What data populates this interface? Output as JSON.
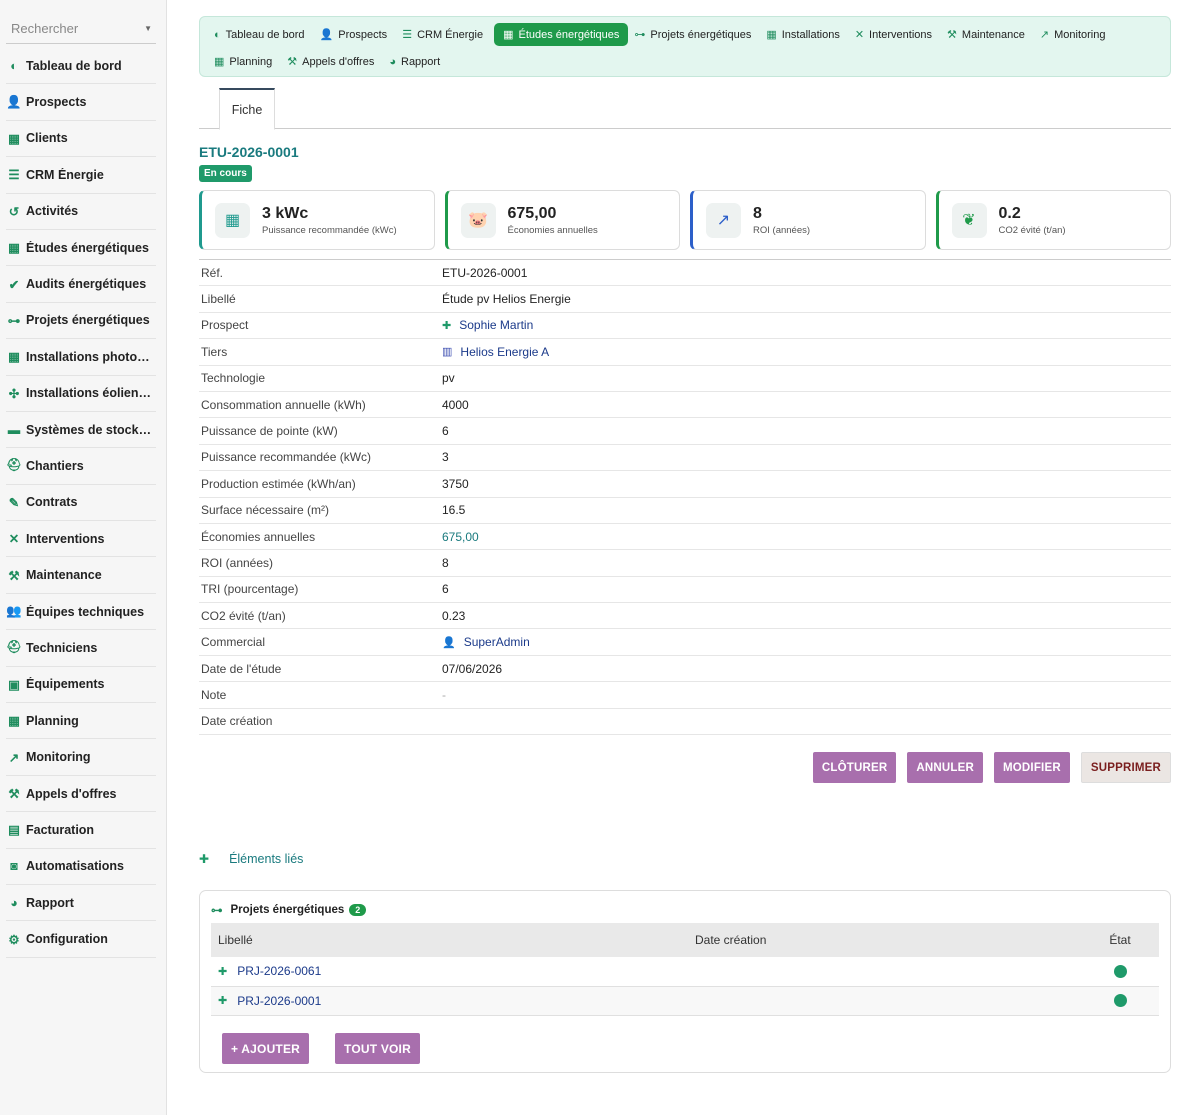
{
  "search": {
    "placeholder": "Rechercher"
  },
  "sidebar": {
    "items": [
      {
        "label": "Tableau de bord",
        "icon": "gauge-icon",
        "glyph": "◐"
      },
      {
        "label": "Prospects",
        "icon": "user-plus-icon",
        "glyph": "👤"
      },
      {
        "label": "Clients",
        "icon": "building-icon",
        "glyph": "▦"
      },
      {
        "label": "CRM Énergie",
        "icon": "list-icon",
        "glyph": "☰"
      },
      {
        "label": "Activités",
        "icon": "history-icon",
        "glyph": "↺"
      },
      {
        "label": "Études énergétiques",
        "icon": "solar-panel-icon",
        "glyph": "▦"
      },
      {
        "label": "Audits énergétiques",
        "icon": "clipboard-check-icon",
        "glyph": "✔"
      },
      {
        "label": "Projets énergétiques",
        "icon": "project-diagram-icon",
        "glyph": "⊶"
      },
      {
        "label": "Installations photov…",
        "icon": "solar-panel-icon",
        "glyph": "▦"
      },
      {
        "label": "Installations éoliennes",
        "icon": "wind-turbine-icon",
        "glyph": "✣"
      },
      {
        "label": "Systèmes de stockage",
        "icon": "battery-icon",
        "glyph": "▬"
      },
      {
        "label": "Chantiers",
        "icon": "hard-hat-icon",
        "glyph": "⛑"
      },
      {
        "label": "Contrats",
        "icon": "file-signature-icon",
        "glyph": "✎"
      },
      {
        "label": "Interventions",
        "icon": "tools-icon",
        "glyph": "✕"
      },
      {
        "label": "Maintenance",
        "icon": "wrench-icon",
        "glyph": "⚒"
      },
      {
        "label": "Équipes techniques",
        "icon": "users-icon",
        "glyph": "👥"
      },
      {
        "label": "Techniciens",
        "icon": "hard-hat-icon",
        "glyph": "⛑"
      },
      {
        "label": "Équipements",
        "icon": "boxes-icon",
        "glyph": "▣"
      },
      {
        "label": "Planning",
        "icon": "calendar-icon",
        "glyph": "▦"
      },
      {
        "label": "Monitoring",
        "icon": "chart-line-icon",
        "glyph": "↗"
      },
      {
        "label": "Appels d'offres",
        "icon": "gavel-icon",
        "glyph": "⚒"
      },
      {
        "label": "Facturation",
        "icon": "invoice-icon",
        "glyph": "▤"
      },
      {
        "label": "Automatisations",
        "icon": "robot-icon",
        "glyph": "◙"
      },
      {
        "label": "Rapport",
        "icon": "chart-pie-icon",
        "glyph": "◕"
      },
      {
        "label": "Configuration",
        "icon": "gear-icon",
        "glyph": "⚙"
      }
    ]
  },
  "topnav": {
    "items": [
      {
        "label": "Tableau de bord",
        "icon": "gauge-icon",
        "glyph": "◐",
        "active": false
      },
      {
        "label": "Prospects",
        "icon": "user-plus-icon",
        "glyph": "👤",
        "active": false
      },
      {
        "label": "CRM Énergie",
        "icon": "list-icon",
        "glyph": "☰",
        "active": false
      },
      {
        "label": "Études énergétiques",
        "icon": "solar-panel-icon",
        "glyph": "▦",
        "active": true
      },
      {
        "label": "Projets énergétiques",
        "icon": "project-diagram-icon",
        "glyph": "⊶",
        "active": false
      },
      {
        "label": "Installations",
        "icon": "solar-panel-icon",
        "glyph": "▦",
        "active": false
      },
      {
        "label": "Interventions",
        "icon": "tools-icon",
        "glyph": "✕",
        "active": false
      },
      {
        "label": "Maintenance",
        "icon": "wrench-icon",
        "glyph": "⚒",
        "active": false
      },
      {
        "label": "Monitoring",
        "icon": "chart-line-icon",
        "glyph": "↗",
        "active": false
      },
      {
        "label": "Planning",
        "icon": "calendar-icon",
        "glyph": "▦",
        "active": false
      },
      {
        "label": "Appels d'offres",
        "icon": "gavel-icon",
        "glyph": "⚒",
        "active": false
      },
      {
        "label": "Rapport",
        "icon": "chart-pie-icon",
        "glyph": "◕",
        "active": false
      }
    ]
  },
  "tabs": {
    "fiche": "Fiche"
  },
  "record": {
    "ref": "ETU-2026-0001",
    "status": "En cours"
  },
  "kpis": [
    {
      "value": "3 kWc",
      "label": "Puissance recommandée (kWc)",
      "icon": "solar-panel-icon",
      "glyph": "▦",
      "color": "#1f9a8e"
    },
    {
      "value": "675,00",
      "label": "Économies annuelles",
      "icon": "piggy-bank-icon",
      "glyph": "🐷",
      "color": "#1f9a4a"
    },
    {
      "value": "8",
      "label": "ROI (années)",
      "icon": "chart-line-icon",
      "glyph": "↗",
      "color": "#2c5fc9"
    },
    {
      "value": "0.2",
      "label": "CO2 évité (t/an)",
      "icon": "leaf-icon",
      "glyph": "❦",
      "color": "#1f9a4a"
    }
  ],
  "fields": [
    {
      "label": "Réf.",
      "value": "ETU-2026-0001",
      "style": ""
    },
    {
      "label": "Libellé",
      "value": "Étude pv Helios Energie",
      "style": ""
    },
    {
      "label": "Prospect",
      "value": "Sophie Martin",
      "style": "link",
      "icon": "prospect-icon",
      "glyph": "✚"
    },
    {
      "label": "Tiers",
      "value": "Helios Energie A",
      "style": "link",
      "icon": "building-icon",
      "glyph": "▥"
    },
    {
      "label": "Technologie",
      "value": "pv",
      "style": ""
    },
    {
      "label": "Consommation annuelle (kWh)",
      "value": "4000",
      "style": ""
    },
    {
      "label": "Puissance de pointe (kW)",
      "value": "6",
      "style": ""
    },
    {
      "label": "Puissance recommandée (kWc)",
      "value": "3",
      "style": ""
    },
    {
      "label": "Production estimée (kWh/an)",
      "value": "3750",
      "style": ""
    },
    {
      "label": "Surface nécessaire (m²)",
      "value": "16.5",
      "style": ""
    },
    {
      "label": "Économies annuelles",
      "value": "675,00",
      "style": "teal"
    },
    {
      "label": "ROI (années)",
      "value": "8",
      "style": ""
    },
    {
      "label": "TRI (pourcentage)",
      "value": "6",
      "style": ""
    },
    {
      "label": "CO2 évité (t/an)",
      "value": "0.23",
      "style": ""
    },
    {
      "label": "Commercial",
      "value": "SuperAdmin",
      "style": "link",
      "icon": "user-icon",
      "glyph": "👤"
    },
    {
      "label": "Date de l'étude",
      "value": "07/06/2026",
      "style": ""
    },
    {
      "label": "Note",
      "value": "-",
      "style": "muted"
    },
    {
      "label": "Date création",
      "value": "",
      "style": ""
    }
  ],
  "actions": {
    "close": "CLÔTURER",
    "cancel": "ANNULER",
    "edit": "MODIFIER",
    "delete": "SUPPRIMER"
  },
  "linked": {
    "title": "Éléments liés",
    "panel_title": "Projets énergétiques",
    "count": "2",
    "columns": [
      "Libellé",
      "Date création",
      "État"
    ],
    "rows": [
      {
        "label": "PRJ-2026-0061",
        "date": "",
        "state": "active"
      },
      {
        "label": "PRJ-2026-0001",
        "date": "",
        "state": "active"
      }
    ],
    "add": "+ AJOUTER",
    "view_all": "TOUT VOIR"
  }
}
